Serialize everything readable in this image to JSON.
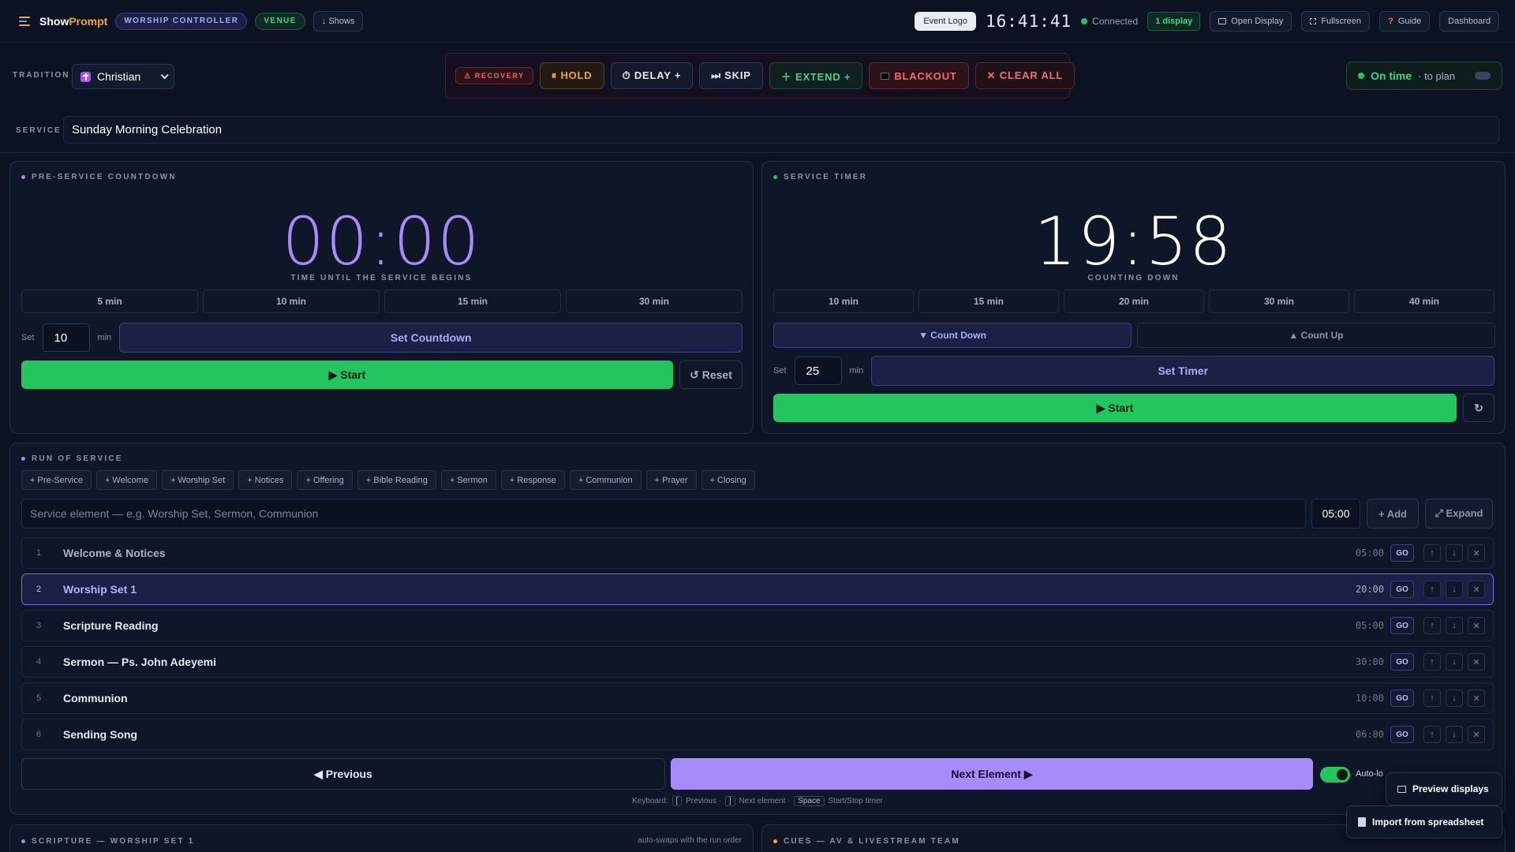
{
  "app": {
    "name_a": "Show",
    "name_b": "Prompt",
    "badge": "WORSHIP CONTROLLER",
    "venue": "VENUE",
    "shows": "↓ Shows"
  },
  "topbar": {
    "event_logo": "Event Logo",
    "clock": "16:41:41",
    "status": "Connected",
    "displays": "1 display",
    "open_display": "Open Display",
    "fullscreen": "Fullscreen",
    "guide": "Guide",
    "dashboard": "Dashboard"
  },
  "tradition": {
    "label": "TRADITION",
    "value": "Christian"
  },
  "controls": {
    "recovery": "⚠ RECOVERY",
    "hold": "⏸ HOLD",
    "delay": "⏱ DELAY +",
    "skip": "⏭ SKIP",
    "extend": "＋ EXTEND +",
    "blackout": "BLACKOUT",
    "clear_all": "✕ CLEAR ALL"
  },
  "status": {
    "label": "On time",
    "sub": "· to plan"
  },
  "service": {
    "label": "SERVICE",
    "value": "Sunday Morning Celebration"
  },
  "countdown": {
    "title": "PRE-SERVICE COUNTDOWN",
    "time": "00:00",
    "caption": "TIME UNTIL THE SERVICE BEGINS",
    "presets": [
      "5 min",
      "10 min",
      "15 min",
      "30 min"
    ],
    "set_label": "Set",
    "set_value": "10",
    "unit": "min",
    "set_button": "Set Countdown",
    "start": "▶ Start",
    "reset": "↺ Reset"
  },
  "timer": {
    "title": "SERVICE TIMER",
    "time": "19:58",
    "caption": "COUNTING DOWN",
    "presets": [
      "10 min",
      "15 min",
      "20 min",
      "30 min",
      "40 min"
    ],
    "count_down": "▼ Count Down",
    "count_up": "▲ Count Up",
    "set_label": "Set",
    "set_value": "25",
    "unit": "min",
    "set_button": "Set Timer",
    "start": "▶ Start",
    "reset": "↻"
  },
  "run": {
    "title": "RUN OF SERVICE",
    "tags": [
      "+ Pre-Service",
      "+ Welcome",
      "+ Worship Set",
      "+ Notices",
      "+ Offering",
      "+ Bible Reading",
      "+ Sermon",
      "+ Response",
      "+ Communion",
      "+ Prayer",
      "+ Closing"
    ],
    "placeholder": "Service element — e.g. Worship Set, Sermon, Communion",
    "duration": "05:00",
    "add": "+ Add",
    "expand": "⤢ Expand",
    "items": [
      {
        "n": "1",
        "title": "Welcome & Notices",
        "dur": "05:00"
      },
      {
        "n": "2",
        "title": "Worship Set 1",
        "dur": "20:00"
      },
      {
        "n": "3",
        "title": "Scripture Reading",
        "dur": "05:00"
      },
      {
        "n": "4",
        "title": "Sermon — Ps. John Adeyemi",
        "dur": "30:00"
      },
      {
        "n": "5",
        "title": "Communion",
        "dur": "10:00"
      },
      {
        "n": "6",
        "title": "Sending Song",
        "dur": "06:00"
      }
    ],
    "go": "GO",
    "previous": "◀ Previous",
    "next": "Next Element ▶",
    "auto": "Auto-lo",
    "kbd_prev_key": "[",
    "kbd_prev": "Previous ·",
    "kbd_next_key": "]",
    "kbd_next": "Next element ·",
    "kbd_space": "Space",
    "kbd_space_text": "Start/Stop timer",
    "kbd_label": "Keyboard:"
  },
  "scripture": {
    "title": "SCRIPTURE — WORSHIP SET 1",
    "note": "auto-swaps with the run order"
  },
  "cues": {
    "title": "CUES — AV & LIVESTREAM TEAM"
  },
  "floating": {
    "preview": "Preview displays",
    "import": "Import from spreadsheet"
  },
  "colors": {
    "accent": "#a78bfa",
    "green": "#22c55e",
    "amber": "#f5a623",
    "red": "#f46a6a",
    "bg": "#0c1222"
  }
}
